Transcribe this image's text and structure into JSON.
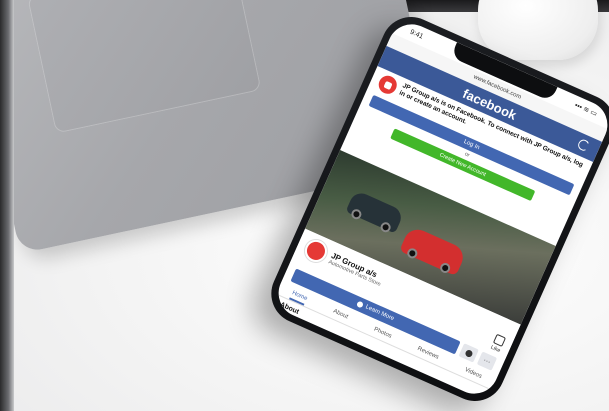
{
  "status": {
    "time": "9:41",
    "signal": "▪▪▪ ≋ ▭"
  },
  "browser": {
    "url": "www.facebook.com"
  },
  "facebook": {
    "logo": "facebook",
    "login_message": "JP Group a/s is on Facebook. To connect with JP Group a/s, log in or create an account.",
    "login_button": "Log In",
    "or_text": "or",
    "create_button": "Create New Account"
  },
  "page": {
    "name": "JP Group a/s",
    "category": "Automotive Parts Store",
    "learn_more": "Learn More",
    "more": "···",
    "like": "Like",
    "about": "About"
  },
  "tabs": [
    "Home",
    "About",
    "Photos",
    "Reviews",
    "Videos"
  ],
  "icons": {
    "reload": "reload-icon",
    "info": "info-icon",
    "messenger": "messenger-icon",
    "like": "thumbs-up-icon"
  },
  "colors": {
    "facebook_blue": "#3b5998",
    "button_blue": "#4267b2",
    "create_green": "#42b72a",
    "brand_red": "#e53935"
  }
}
